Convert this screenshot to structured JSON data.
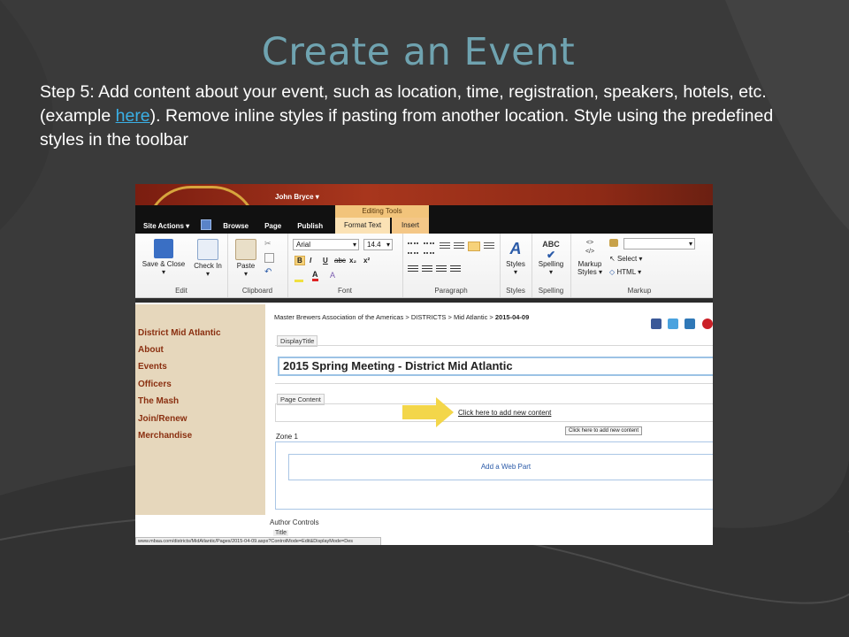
{
  "slide": {
    "title": "Create an Event",
    "step_before": "Step 5: Add content about your event, such as location, time, registration, speakers, hotels, etc. (example ",
    "step_link": "here",
    "step_after": "). Remove inline styles if pasting from another location. Style using the predefined styles in the toolbar"
  },
  "colors": {
    "title": "#6fa3b0",
    "background": "#3b3b3b",
    "link": "#3ab0e6",
    "nav_text": "#8a2f10"
  },
  "sharepoint": {
    "user": "John Bryce",
    "tabs": [
      "Site Actions",
      "Browse",
      "Page",
      "Publish"
    ],
    "editing_tools": "Editing Tools",
    "tab_format_text": "Format Text",
    "tab_insert": "Insert",
    "ribbon": {
      "save_close": "Save & Close",
      "check_in": "Check In",
      "group_edit": "Edit",
      "paste": "Paste",
      "group_clipboard": "Clipboard",
      "font_name": "Arial",
      "font_size": "14.4",
      "bold": "B",
      "italic": "I",
      "underline": "U",
      "strike": "abc",
      "subscript": "x₂",
      "superscript": "x²",
      "group_font": "Font",
      "group_paragraph": "Paragraph",
      "styles": "Styles",
      "group_styles": "Styles",
      "spelling_icon": "ABC",
      "spelling": "Spelling",
      "group_spelling": "Spelling",
      "markup_styles_1": "Markup",
      "markup_styles_2": "Styles",
      "select": "Select",
      "html": "HTML",
      "group_markup": "Markup"
    },
    "nav": [
      "District Mid Atlantic",
      "About",
      "Events",
      "Officers",
      "The Mash",
      "Join/Renew",
      "Merchandise"
    ],
    "breadcrumb": "Master Brewers Association of the Americas > DISTRICTS > Mid Atlantic > ",
    "breadcrumb_current": "2015-04-09",
    "field_display_title": "DisplayTitle",
    "display_title_value": "2015 Spring Meeting - District Mid Atlantic",
    "field_page_content": "Page Content",
    "add_content_link": "Click here to add new content",
    "tooltip": "Click here to add new content",
    "zone": "Zone 1",
    "add_web_part": "Add a Web Part",
    "author_controls": "Author Controls",
    "title_label": "Title",
    "status_url": "www.mbaa.com/districts/MidAtlantic/Pages/2015-04-09.aspx?ControlMode=Edit&DisplayMode=Des"
  }
}
